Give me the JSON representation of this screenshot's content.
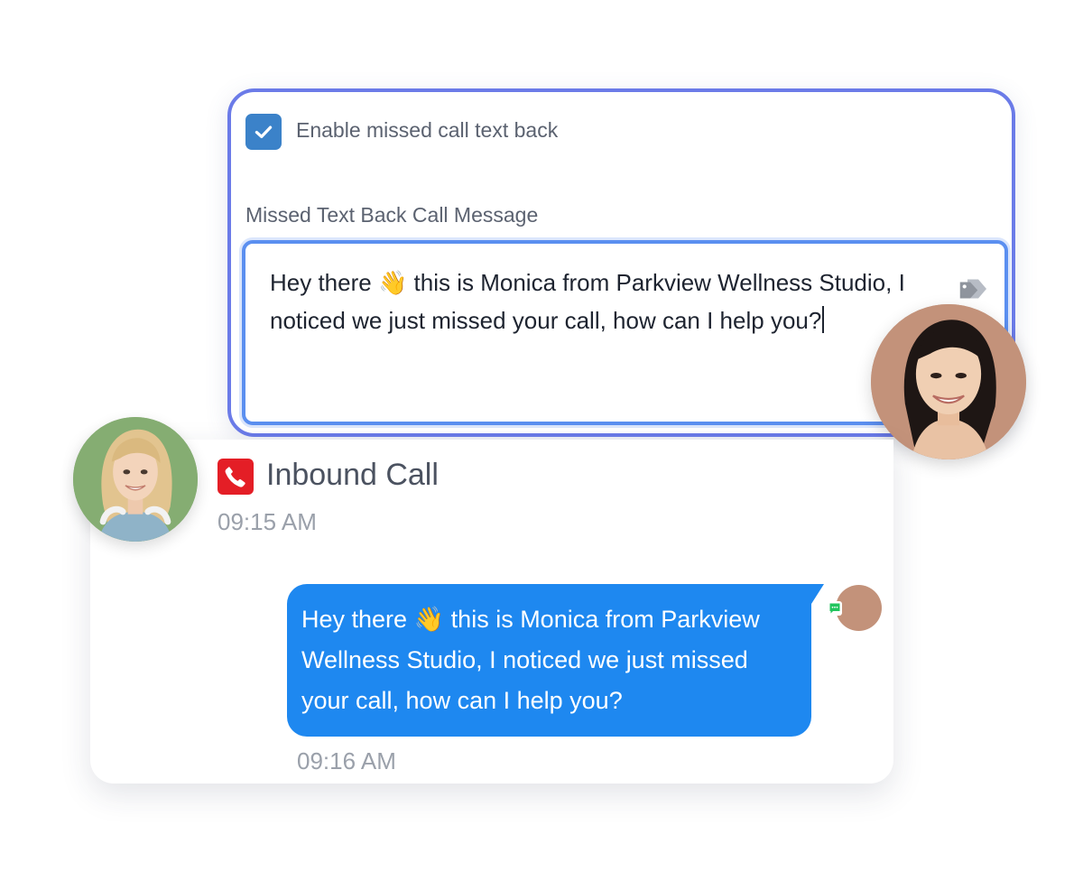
{
  "settings": {
    "enable_label": "Enable missed call text back",
    "enable_checked": true,
    "message_label": "Missed Text Back Call Message",
    "message_text": "Hey there 👋 this is Monica from Parkview Wellness Studio, I noticed we just missed your call, how can I help you?"
  },
  "conversation": {
    "call_type": "Inbound Call",
    "call_time": "09:15 AM",
    "message_text": "Hey there 👋 this is Monica from Parkview Wellness Studio, I noticed we just missed your call, how can I help you?",
    "message_time": "09:16 AM"
  },
  "icons": {
    "checkbox": "check-icon",
    "tag": "tag-icon",
    "call": "phone-icon",
    "sms": "sms-icon"
  },
  "colors": {
    "card_border": "#6b7be8",
    "field_border": "#5b8ff0",
    "checkbox": "#3b82c9",
    "call_icon": "#e41e26",
    "bubble": "#1e88f0",
    "sms_badge": "#22c55e"
  }
}
